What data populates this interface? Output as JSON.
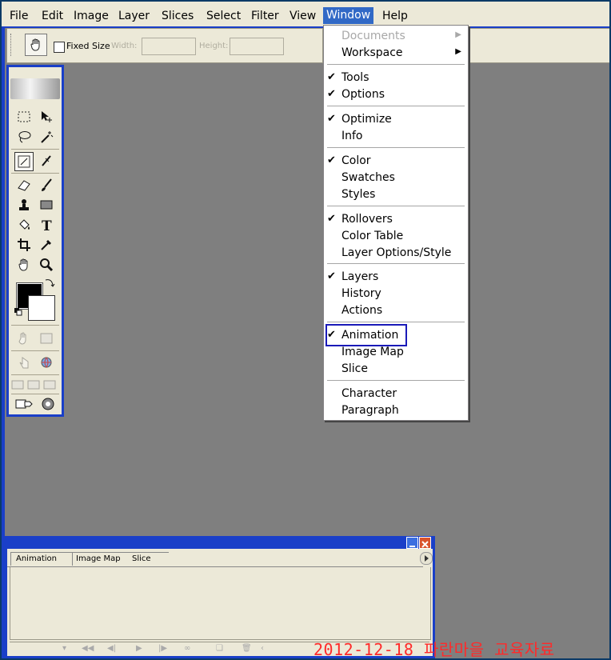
{
  "menubar": {
    "items": [
      {
        "label": "File",
        "active": false
      },
      {
        "label": "Edit",
        "active": false
      },
      {
        "label": "Image",
        "active": false
      },
      {
        "label": "Layer",
        "active": false
      },
      {
        "label": "Slices",
        "active": false
      },
      {
        "label": "Select",
        "active": false
      },
      {
        "label": "Filter",
        "active": false
      },
      {
        "label": "View",
        "active": false
      },
      {
        "label": "Window",
        "active": true
      },
      {
        "label": "Help",
        "active": false
      }
    ]
  },
  "options": {
    "fixed_size_label": "Fixed Size",
    "fixed_size_checked": false,
    "width_label": "Width:",
    "width_value": "",
    "height_label": "Height:",
    "height_value": ""
  },
  "tools": {
    "icons": [
      "marquee-icon",
      "move-icon",
      "lasso-icon",
      "magic-wand-icon",
      "slice-icon",
      "slice-select-icon",
      "eraser-icon",
      "brush-icon",
      "stamp-icon",
      "rectangle-icon",
      "paint-bucket-icon",
      "type-icon",
      "crop-icon",
      "eyedropper-icon",
      "hand-icon",
      "zoom-icon"
    ],
    "foreground_color": "#000000",
    "background_color": "#ffffff"
  },
  "window_menu": {
    "documents": "Documents",
    "workspace": "Workspace",
    "tools": "Tools",
    "options": "Options",
    "optimize": "Optimize",
    "info": "Info",
    "color": "Color",
    "swatches": "Swatches",
    "styles": "Styles",
    "rollovers": "Rollovers",
    "color_table": "Color Table",
    "layer_options": "Layer Options/Style",
    "layers": "Layers",
    "history": "History",
    "actions": "Actions",
    "animation": "Animation",
    "image_map": "Image Map",
    "slice": "Slice",
    "character": "Character",
    "paragraph": "Paragraph",
    "checked": [
      "Tools",
      "Options",
      "Optimize",
      "Color",
      "Rollovers",
      "Layers",
      "Animation"
    ],
    "highlighted": "Animation"
  },
  "panel": {
    "tabs": [
      "Animation",
      "Image Map",
      "Slice"
    ],
    "active_tab": "Animation"
  },
  "watermark": "2012-12-18 파란마을 교육자료",
  "colors": {
    "accent": "#1a3fc8",
    "menu_highlight": "#3169c6",
    "workspace": "#7f7f7f",
    "watermark": "#ff2a2a"
  }
}
